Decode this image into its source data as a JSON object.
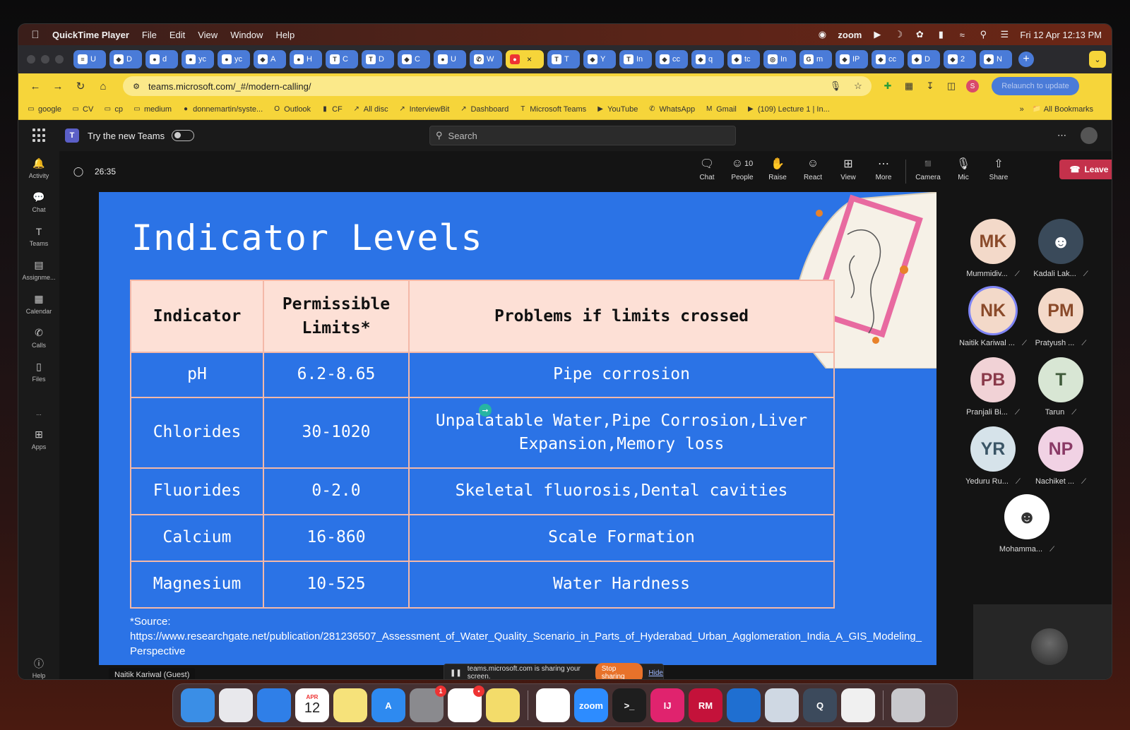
{
  "menubar": {
    "app_name": "QuickTime Player",
    "menus": [
      "File",
      "Edit",
      "View",
      "Window",
      "Help"
    ],
    "zoom_label": "zoom",
    "datetime": "Fri 12 Apr  12:13 PM"
  },
  "browser": {
    "tabs": [
      {
        "label": "U",
        "icon": "docs-icon"
      },
      {
        "label": "D",
        "icon": "tab-icon"
      },
      {
        "label": "d",
        "icon": "github-icon"
      },
      {
        "label": "yc",
        "icon": "github-icon"
      },
      {
        "label": "yc",
        "icon": "github-icon"
      },
      {
        "label": "A",
        "icon": "tab-icon"
      },
      {
        "label": "H",
        "icon": "github-icon"
      },
      {
        "label": "C",
        "icon": "teams-icon"
      },
      {
        "label": "D",
        "icon": "teams-icon"
      },
      {
        "label": "C",
        "icon": "tab-icon"
      },
      {
        "label": "U",
        "icon": "github-icon"
      },
      {
        "label": "W",
        "icon": "whatsapp-icon"
      },
      {
        "label": "T",
        "icon": "teams-icon"
      },
      {
        "label": "Y",
        "icon": "tab-icon"
      },
      {
        "label": "In",
        "icon": "teams-icon"
      },
      {
        "label": "cc",
        "icon": "tab-icon"
      },
      {
        "label": "q",
        "icon": "tab-icon"
      },
      {
        "label": "tc",
        "icon": "tab-icon"
      },
      {
        "label": "In",
        "icon": "instagram-icon"
      },
      {
        "label": "m",
        "icon": "google-icon"
      },
      {
        "label": "IP",
        "icon": "tab-icon"
      },
      {
        "label": "cc",
        "icon": "tab-icon"
      },
      {
        "label": "D",
        "icon": "tab-icon"
      },
      {
        "label": "2",
        "icon": "tab-icon"
      },
      {
        "label": "N",
        "icon": "tab-icon"
      }
    ],
    "url": "teams.microsoft.com/_#/modern-calling/",
    "profile_initial": "S",
    "relaunch_label": "Relaunch to update",
    "bookmarks": [
      {
        "label": "google",
        "icon": "folder-icon"
      },
      {
        "label": "CV",
        "icon": "folder-icon"
      },
      {
        "label": "cp",
        "icon": "folder-icon"
      },
      {
        "label": "medium",
        "icon": "folder-icon"
      },
      {
        "label": "donnemartin/syste...",
        "icon": "github-icon"
      },
      {
        "label": "Outlook",
        "icon": "outlook-icon"
      },
      {
        "label": "CF",
        "icon": "chart-icon"
      },
      {
        "label": "All disc",
        "icon": "link-icon"
      },
      {
        "label": "InterviewBit",
        "icon": "link-icon"
      },
      {
        "label": "Dashboard",
        "icon": "link-icon"
      },
      {
        "label": "Microsoft Teams",
        "icon": "teams-icon"
      },
      {
        "label": "YouTube",
        "icon": "youtube-icon"
      },
      {
        "label": "WhatsApp",
        "icon": "whatsapp-icon"
      },
      {
        "label": "Gmail",
        "icon": "gmail-icon"
      },
      {
        "label": "(109) Lecture 1 | In...",
        "icon": "youtube-icon"
      }
    ],
    "all_bookmarks_label": "All Bookmarks"
  },
  "teams": {
    "try_new_label": "Try the new Teams",
    "search_placeholder": "Search",
    "rail": [
      {
        "label": "Activity",
        "icon": "bell-icon"
      },
      {
        "label": "Chat",
        "icon": "chat-icon"
      },
      {
        "label": "Teams",
        "icon": "teams-icon"
      },
      {
        "label": "Assignme...",
        "icon": "assignment-icon"
      },
      {
        "label": "Calendar",
        "icon": "calendar-icon"
      },
      {
        "label": "Calls",
        "icon": "phone-icon"
      },
      {
        "label": "Files",
        "icon": "file-icon"
      },
      {
        "label": "...",
        "icon": "more-icon"
      },
      {
        "label": "Apps",
        "icon": "apps-icon"
      }
    ],
    "help_label": "Help",
    "timer": "26:35",
    "controls": {
      "chat": "Chat",
      "people": "People",
      "people_count": "10",
      "raise": "Raise",
      "react": "React",
      "view": "View",
      "more": "More",
      "camera": "Camera",
      "mic": "Mic",
      "share": "Share",
      "leave": "Leave"
    },
    "participants": [
      {
        "initials": "MK",
        "name": "Mummidiv...",
        "bg": "#f3d9c9",
        "fg": "#8a4a2a"
      },
      {
        "initials": "",
        "name": "Kadali Lak...",
        "bg": "#3a4a5a",
        "fg": "#ffffff"
      },
      {
        "initials": "NK",
        "name": "Naitik Kariwal ...",
        "bg": "#f3d9c9",
        "fg": "#8a4a2a"
      },
      {
        "initials": "PM",
        "name": "Pratyush ...",
        "bg": "#f3d9c9",
        "fg": "#8a4a2a"
      },
      {
        "initials": "PB",
        "name": "Pranjali Bi...",
        "bg": "#f1d2d6",
        "fg": "#8a3a4a"
      },
      {
        "initials": "T",
        "name": "Tarun",
        "bg": "#d8e6d4",
        "fg": "#3f5a3a"
      },
      {
        "initials": "YR",
        "name": "Yeduru Ru...",
        "bg": "#d6e3ea",
        "fg": "#3a5566"
      },
      {
        "initials": "NP",
        "name": "Nachiket ...",
        "bg": "#f1d2e4",
        "fg": "#8a3a66"
      },
      {
        "initials": "",
        "name": "Mohamma...",
        "bg": "#ffffff",
        "fg": "#333333"
      }
    ],
    "presenter_tag": "Naitik Kariwal (Guest)",
    "share_banner": {
      "text": "teams.microsoft.com is sharing your screen.",
      "stop": "Stop sharing",
      "hide": "Hide"
    }
  },
  "slide": {
    "title": "Indicator Levels",
    "headers": [
      "Indicator",
      "Permissible Limits*",
      "Problems if limits crossed"
    ],
    "rows": [
      [
        "pH",
        "6.2-8.65",
        "Pipe corrosion"
      ],
      [
        "Chlorides",
        "30-1020",
        "Unpalatable Water,Pipe Corrosion,Liver Expansion,Memory loss"
      ],
      [
        "Fluorides",
        "0-2.0",
        "Skeletal fluorosis,Dental cavities"
      ],
      [
        "Calcium",
        "16-860",
        "Scale Formation"
      ],
      [
        "Magnesium",
        "10-525",
        "Water Hardness"
      ]
    ],
    "source_label": "*Source:",
    "source_url": "https://www.researchgate.net/publication/281236507_Assessment_of_Water_Quality_Scenario_in_Parts_of_Hyderabad_Urban_Agglomeration_India_A_GIS_Modeling_Perspective",
    "bg_color": "#2b73e6",
    "header_color": "#fde0d6"
  },
  "dock": {
    "apps": [
      {
        "name": "finder",
        "label": "",
        "bg": "#3a8ee6"
      },
      {
        "name": "launchpad",
        "label": "",
        "bg": "#e8e8ec"
      },
      {
        "name": "safari",
        "label": "",
        "bg": "#2f7fe8"
      },
      {
        "name": "calendar",
        "label": "12",
        "month": "APR",
        "bg": "#ffffff"
      },
      {
        "name": "notes",
        "label": "",
        "bg": "#f6e27a"
      },
      {
        "name": "app-store",
        "label": "A",
        "bg": "#2e8af0"
      },
      {
        "name": "system-settings",
        "label": "",
        "bg": "#8a8a8e",
        "badge": "1"
      },
      {
        "name": "slack",
        "label": "",
        "bg": "#ffffff",
        "badge": "•"
      },
      {
        "name": "stickies",
        "label": "",
        "bg": "#f3dc6a"
      },
      {
        "name": "chrome",
        "label": "",
        "bg": "#ffffff"
      },
      {
        "name": "zoom",
        "label": "zoom",
        "bg": "#2d8cff"
      },
      {
        "name": "terminal",
        "label": ">_",
        "bg": "#1e1e1e"
      },
      {
        "name": "intellij",
        "label": "IJ",
        "bg": "#e0236e"
      },
      {
        "name": "rubymine",
        "label": "RM",
        "bg": "#c4123a"
      },
      {
        "name": "vscode",
        "label": "",
        "bg": "#1f6fd1"
      },
      {
        "name": "preview",
        "label": "",
        "bg": "#cfd8e3"
      },
      {
        "name": "quicktime",
        "label": "Q",
        "bg": "#3c4a5c"
      },
      {
        "name": "documents",
        "label": "",
        "bg": "#f0f0f0"
      },
      {
        "name": "trash",
        "label": "",
        "bg": "#c8c8cc"
      }
    ]
  }
}
